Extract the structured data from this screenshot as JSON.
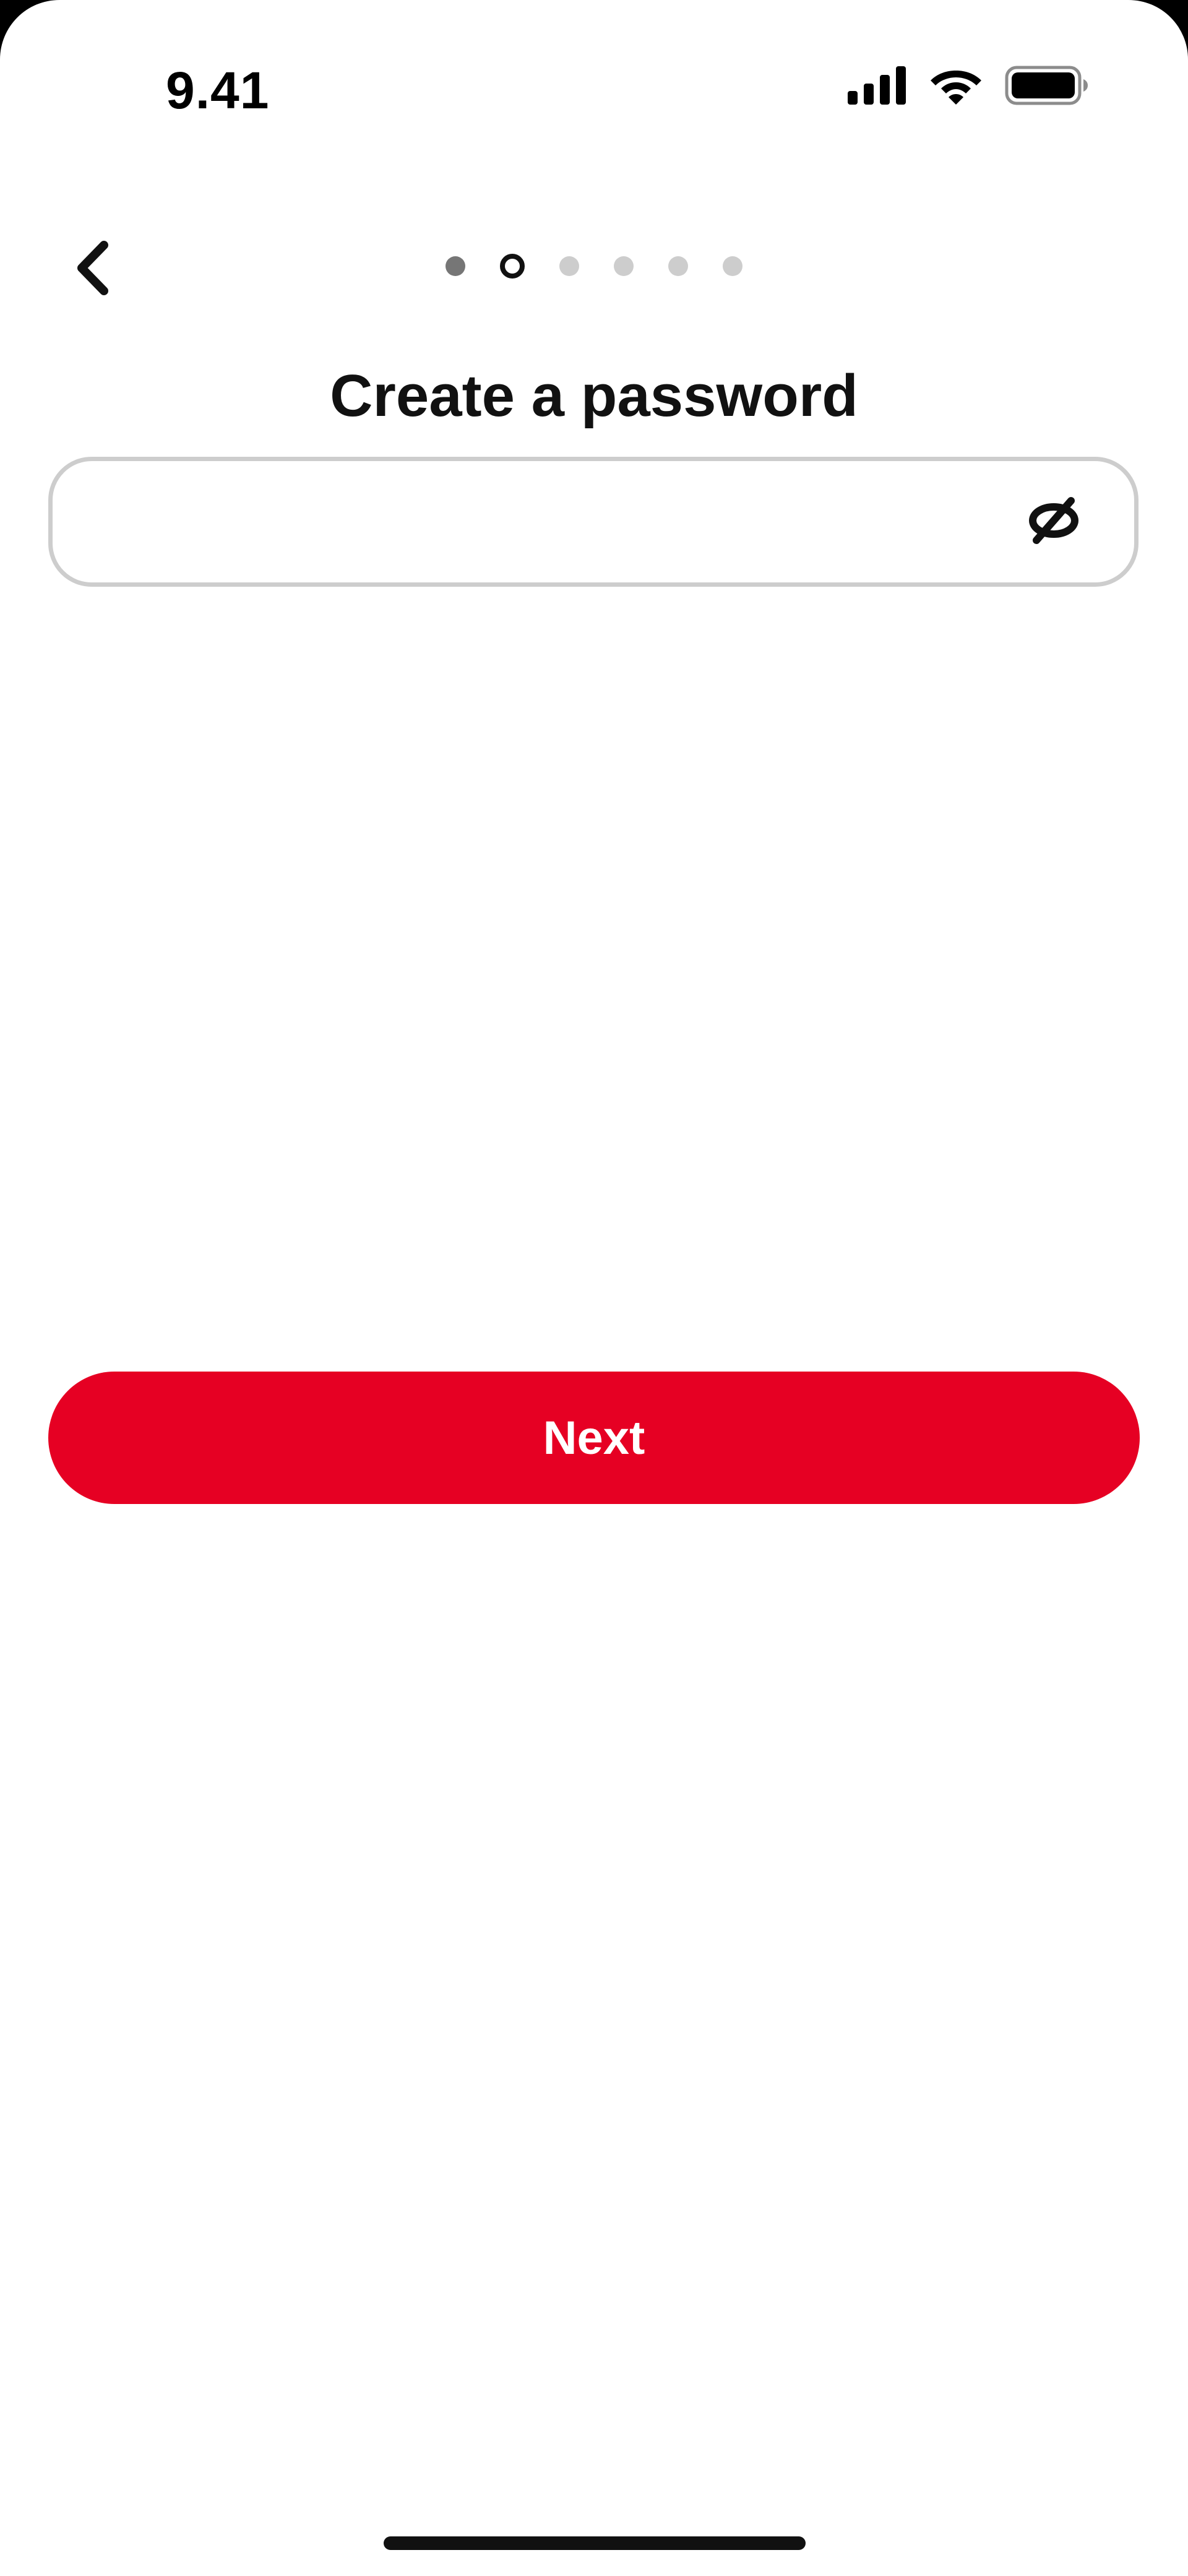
{
  "status_bar": {
    "time": "9.41",
    "icons": [
      "cellular-signal-icon",
      "wifi-icon",
      "battery-icon"
    ]
  },
  "navigation": {
    "back_icon": "chevron-left-icon",
    "progress": {
      "total_steps": 6,
      "current_step": 2
    }
  },
  "page": {
    "title": "Create a password"
  },
  "password_field": {
    "value": "",
    "placeholder": "",
    "toggle_icon": "eye-off-icon"
  },
  "next_button": {
    "label": "Next"
  },
  "colors": {
    "accent": "#e60023",
    "field_border": "#cdcdcd",
    "dot_done": "#767676",
    "dot_upcoming": "#cdcdcd",
    "text": "#111111"
  }
}
